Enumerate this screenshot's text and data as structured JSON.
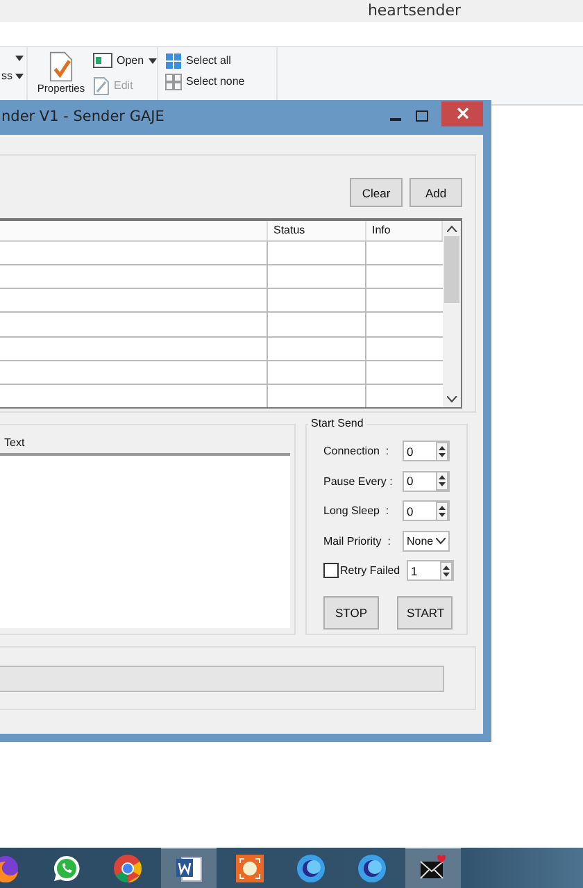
{
  "explorer": {
    "title": "heartsender",
    "ribbon": [
      {
        "kind": "caret_only"
      },
      {
        "kind": "text_caret",
        "label": "ss"
      },
      {
        "kind": "properties",
        "label": "Properties"
      },
      {
        "kind": "open",
        "label": "Open",
        "disabled": false
      },
      {
        "kind": "edit",
        "label": "Edit",
        "disabled": true
      },
      {
        "kind": "select_all",
        "label": "Select all"
      },
      {
        "kind": "select_none",
        "label": "Select none"
      }
    ]
  },
  "app": {
    "title": "nder V1 - Sender GAJE",
    "list_buttons": [
      "Clear",
      "Add"
    ],
    "table": {
      "columns": [
        "Status",
        "Info"
      ]
    },
    "text_panel": {
      "header": "Text"
    },
    "start_send": {
      "title": "Start Send",
      "fields": [
        {
          "kind": "spin",
          "label": "Connection  :",
          "value": "0"
        },
        {
          "kind": "spin",
          "label": "Pause Every :",
          "value": "0"
        },
        {
          "kind": "spin",
          "label": "Long Sleep  :",
          "value": "0"
        },
        {
          "kind": "select",
          "label": "Mail Priority  :",
          "value": "None"
        },
        {
          "kind": "check_spin",
          "label": "Retry Failed",
          "checked": false,
          "value": "1"
        }
      ],
      "buttons": [
        "STOP",
        "START"
      ]
    },
    "progress": {
      "level": 0
    }
  },
  "taskbar": [
    {
      "kind": "fox",
      "active": false
    },
    {
      "kind": "chat",
      "active": false
    },
    {
      "kind": "chrome",
      "active": false
    },
    {
      "kind": "word",
      "active": true
    },
    {
      "kind": "camera",
      "active": false
    },
    {
      "kind": "crescent",
      "active": false
    },
    {
      "kind": "crescent",
      "active": false
    },
    {
      "kind": "mail",
      "active": true
    }
  ]
}
